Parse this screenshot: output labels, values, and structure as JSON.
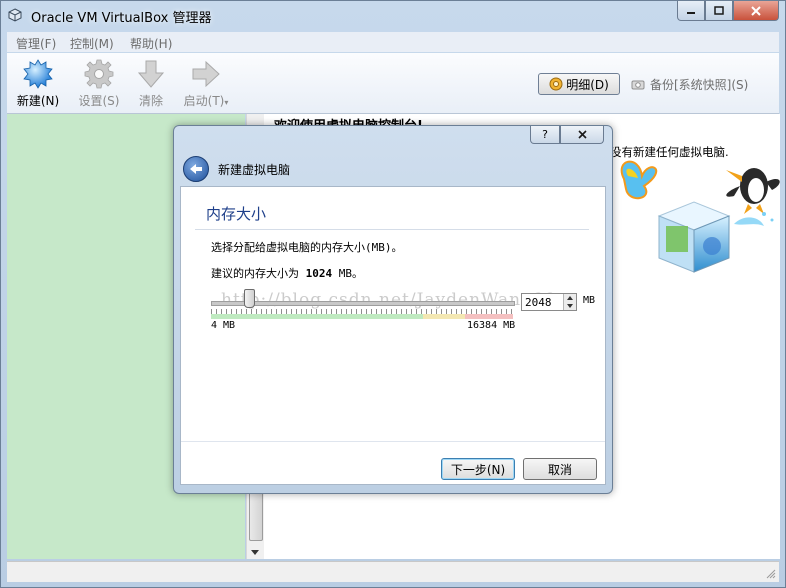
{
  "window": {
    "title": "Oracle VM VirtualBox 管理器"
  },
  "menu": [
    "管理(F)",
    "控制(M)",
    "帮助(H)"
  ],
  "toolbar": {
    "new": "新建(N)",
    "settings": "设置(S)",
    "discard": "清除",
    "start": "启动(T)"
  },
  "view_buttons": {
    "details": "明细(D)",
    "snapshots": "备份[系统快照](S)"
  },
  "welcome": {
    "title": "欢迎使用虚拟电脑控制台!",
    "line_right": "没有新建任何虚拟电脑."
  },
  "dialog": {
    "title": "新建虚拟电脑",
    "help": "?",
    "page_title": "内存大小",
    "prompt": "选择分配给虚拟电脑的内存大小(MB)。",
    "recommend_prefix": "建议的内存大小为",
    "recommend_value": "1024",
    "recommend_suffix": "MB。",
    "memory_value": "2048",
    "unit": "MB",
    "min_label": "4 MB",
    "max_label": "16384 MB",
    "memory_fraction": 0.125,
    "watermark": "http://blog.csdn.net/JaydenWang33",
    "next": "下一步(N)",
    "cancel": "取消"
  },
  "colors": {
    "accent": "#1e3f8a",
    "left_pane": "#c6e8c9",
    "chrome": "#bccfe3"
  }
}
